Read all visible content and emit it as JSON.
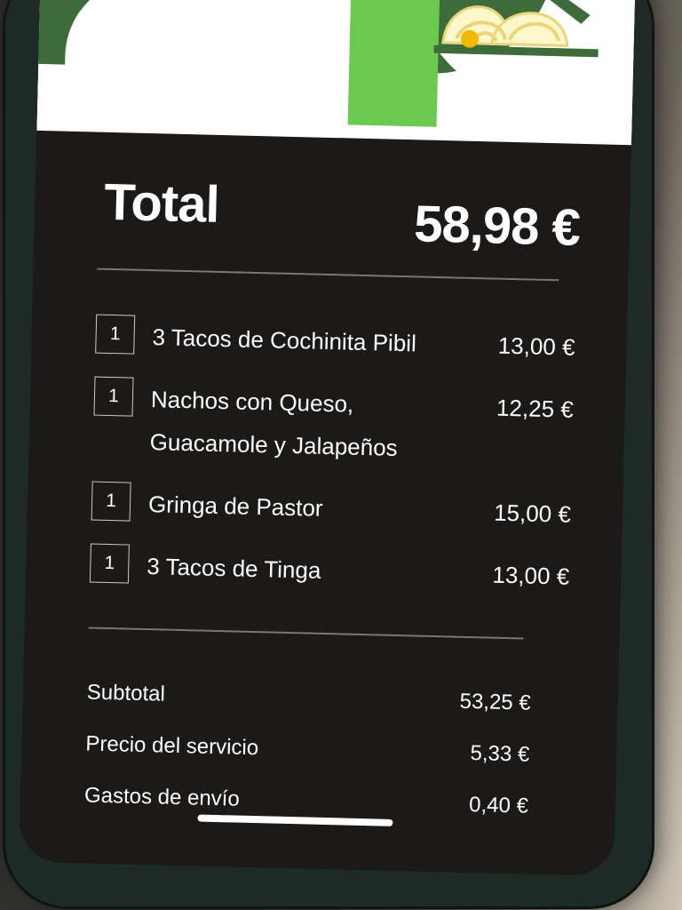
{
  "order": {
    "total_label": "Total",
    "total_amount": "58,98 €",
    "items": [
      {
        "qty": "1",
        "name": "3 Tacos de Cochinita Pibil",
        "price": "13,00 €"
      },
      {
        "qty": "1",
        "name": "Nachos con Queso, Guacamole y Jalapeños",
        "price": "12,25 €"
      },
      {
        "qty": "1",
        "name": "Gringa de Pastor",
        "price": "15,00 €"
      },
      {
        "qty": "1",
        "name": "3 Tacos de Tinga",
        "price": "13,00 €"
      }
    ],
    "subtotal_label": "Subtotal",
    "subtotal_amount": "53,25 €",
    "service_label": "Precio del servicio",
    "service_amount": "5,33 €",
    "delivery_label": "Gastos de envío",
    "delivery_amount": "0,40 €"
  },
  "colors": {
    "screen_background": "#1b1a19",
    "accent_green": "#6cc94f",
    "dark_green": "#3d6b3a"
  },
  "icons": {
    "hero": "food-bowl-icon"
  }
}
